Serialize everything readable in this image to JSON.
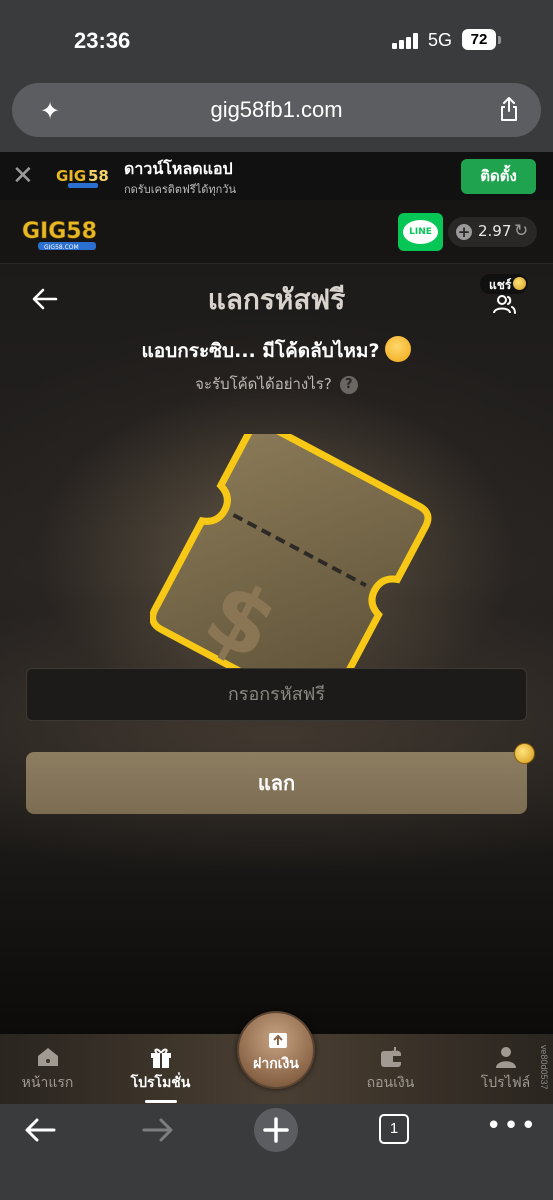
{
  "status_bar": {
    "time": "23:36",
    "network": "5G",
    "battery": "72"
  },
  "browser": {
    "url": "gig58fb1.com",
    "open_tabs": "1"
  },
  "app_banner": {
    "title": "ดาวน์โหลดแอป",
    "subtitle": "กดรับเครดิตฟรีได้ทุกวัน",
    "install_label": "ติดตั้ง"
  },
  "header": {
    "logo_text": "GIG58",
    "logo_sub": "GIG58.COM",
    "line_label": "LINE",
    "balance": "2.97"
  },
  "page": {
    "title": "แลกรหัสฟรี",
    "share_label": "แชร์",
    "subtitle": "แอบกระซิบ... มีโค้ดลับไหม?",
    "help_text": "จะรับโค้ดได้อย่างไร?",
    "help_icon": "?",
    "input_placeholder": "กรอกรหัสฟรี",
    "redeem_label": "แลก"
  },
  "tabs": [
    {
      "label": "หน้าแรก",
      "icon": "home-icon"
    },
    {
      "label": "โปรโมชั่น",
      "icon": "gift-icon",
      "active": true
    },
    {
      "label": "ฝากเงิน",
      "icon": "deposit-icon"
    },
    {
      "label": "ถอนเงิน",
      "icon": "wallet-icon"
    },
    {
      "label": "โปรไฟล์",
      "icon": "user-icon"
    }
  ],
  "version": "ve80d0537",
  "colors": {
    "install_green": "#1fa34f",
    "line_green": "#06c755",
    "gold": "#e8b923",
    "redeem_button": "#8d7d61"
  }
}
